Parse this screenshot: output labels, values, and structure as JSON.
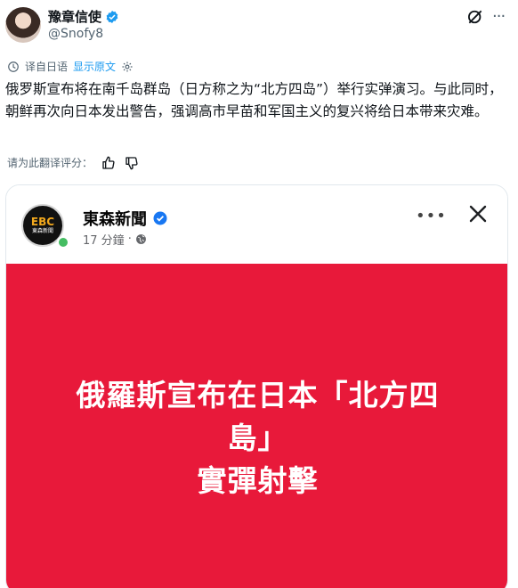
{
  "tweet": {
    "display_name": "豫章信使",
    "handle": "@Snofy8",
    "translated_from": "译自日语",
    "show_original": "显示原文",
    "text": "俄罗斯宣布将在南千岛群岛（日方称之为“北方四岛”）举行实弹演习。与此同时，朝鲜再次向日本发出警告，强调高市早苗和军国主义的复兴将给日本带来灾难。",
    "rate_translation": "请为此翻译评分：",
    "icons": {
      "verified": "verified-badge-icon",
      "grok": "grok-icon",
      "more": "more-options-icon",
      "translate": "translate-icon",
      "settings": "gear-icon",
      "thumbs_up": "thumbs-up-icon",
      "thumbs_down": "thumbs-down-icon"
    },
    "accent_color": "#1d9bf0"
  },
  "embedded_post": {
    "page_name": "東森新聞",
    "logo_text": "EBC",
    "logo_sub": "東森新聞",
    "time": "17 分鐘",
    "separator": "·",
    "banner_lines": [
      "俄羅斯宣布在日本「北方四",
      "島」",
      "實彈射擊"
    ],
    "banner_color": "#e8193a",
    "icons": {
      "verified": "verified-badge-icon",
      "globe": "globe-icon",
      "more": "more-options-icon",
      "close": "close-icon"
    }
  }
}
